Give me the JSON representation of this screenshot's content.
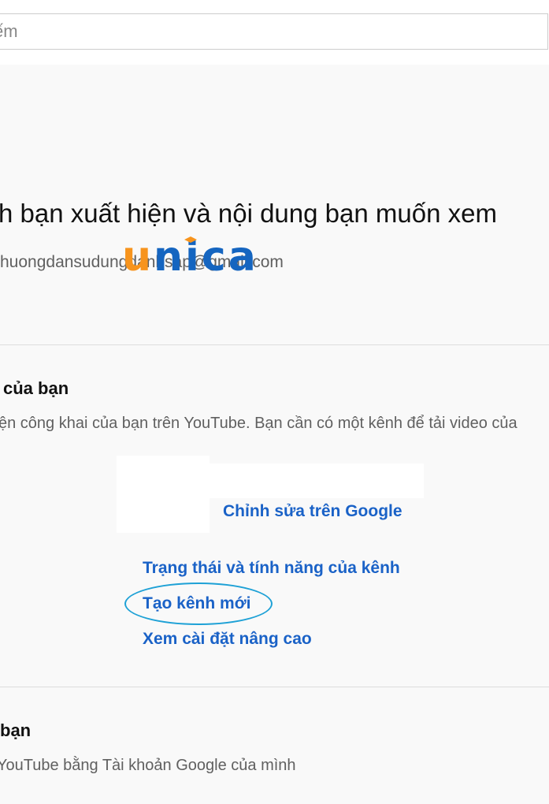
{
  "search": {
    "value": "ếm",
    "placeholder": "Tìm kiếm"
  },
  "profile": {
    "heading": "h bạn xuất hiện và nội dung bạn muốn xem",
    "email": "huongdansudungdanhsap@gmail.com"
  },
  "watermark": {
    "letter_u": "u",
    "letters_rest": "nica",
    "colors": {
      "orange": "#f7941d",
      "blue": "#1565c0"
    }
  },
  "channel_section": {
    "title": "của bạn",
    "description": "ện công khai của bạn trên YouTube. Bạn cần có một kênh để tải video của",
    "edit_link": "Chỉnh sửa trên Google",
    "links": [
      {
        "label": "Trạng thái và tính năng của kênh"
      },
      {
        "label": "Tạo kênh mới"
      },
      {
        "label": "Xem cài đặt nâng cao"
      }
    ]
  },
  "account_section": {
    "title": "bạn",
    "description": "YouTube bằng Tài khoản Google của mình"
  },
  "colors": {
    "link": "#1a62c7",
    "highlight": "#1ea1d6",
    "background": "#f9f9f9"
  }
}
